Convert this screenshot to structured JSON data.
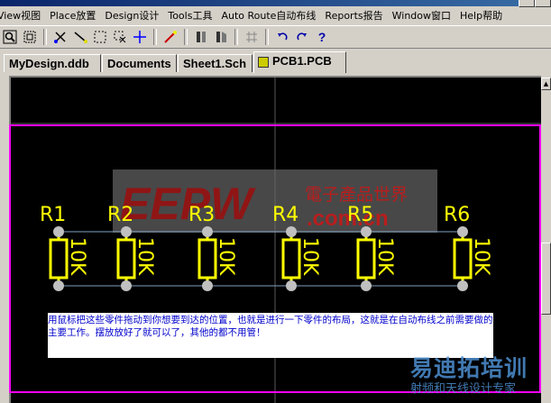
{
  "window": {
    "title": "[MyDesign.ddb]"
  },
  "menu": [
    {
      "label": "View视图"
    },
    {
      "label": "Place放置"
    },
    {
      "label": "Design设计"
    },
    {
      "label": "Tools工具"
    },
    {
      "label": "Auto Route自动布线"
    },
    {
      "label": "Reports报告"
    },
    {
      "label": "Window窗口"
    },
    {
      "label": "Help帮助"
    }
  ],
  "toolbar": {
    "icons": [
      "zoom-fit-icon",
      "zoom-area-icon",
      "cut-icon",
      "wire-icon",
      "select-box-icon",
      "deselect-icon",
      "move-icon",
      "magic-wand-icon",
      "component-icon",
      "component-alt-icon",
      "grid-icon",
      "undo-icon",
      "redo-icon",
      "help-icon"
    ]
  },
  "tabs": [
    {
      "label": "MyDesign.ddb"
    },
    {
      "label": "Documents"
    },
    {
      "label": "Sheet1.Sch"
    },
    {
      "label": "PCB1.PCB",
      "active": true
    }
  ],
  "pcb": {
    "components": [
      {
        "ref": "R1",
        "value": "10K"
      },
      {
        "ref": "R2",
        "value": "10K"
      },
      {
        "ref": "R3",
        "value": "10K"
      },
      {
        "ref": "R4",
        "value": "10K"
      },
      {
        "ref": "R5",
        "value": "10K"
      },
      {
        "ref": "R6",
        "value": "10K"
      }
    ],
    "colors": {
      "board_outline": "#ff00ff",
      "silkscreen": "#ffff00",
      "pad": "#c0c0c0",
      "ratsnest": "#7f9fbf",
      "background": "#000000"
    }
  },
  "caption": "用鼠标把这些零件拖动到你想要到达的位置，也就是进行一下零件的布局，这就是在自动布线之前需要做的主要工作。摆放放好了就可以了，其他的都不用管！",
  "watermark": {
    "logo": "EEPW",
    "logo_domain": ".com.cn",
    "logo_tagline": "電子產品世界",
    "corner_cn": "易迪拓培训",
    "corner_sub": "射频和天线设计专家"
  }
}
